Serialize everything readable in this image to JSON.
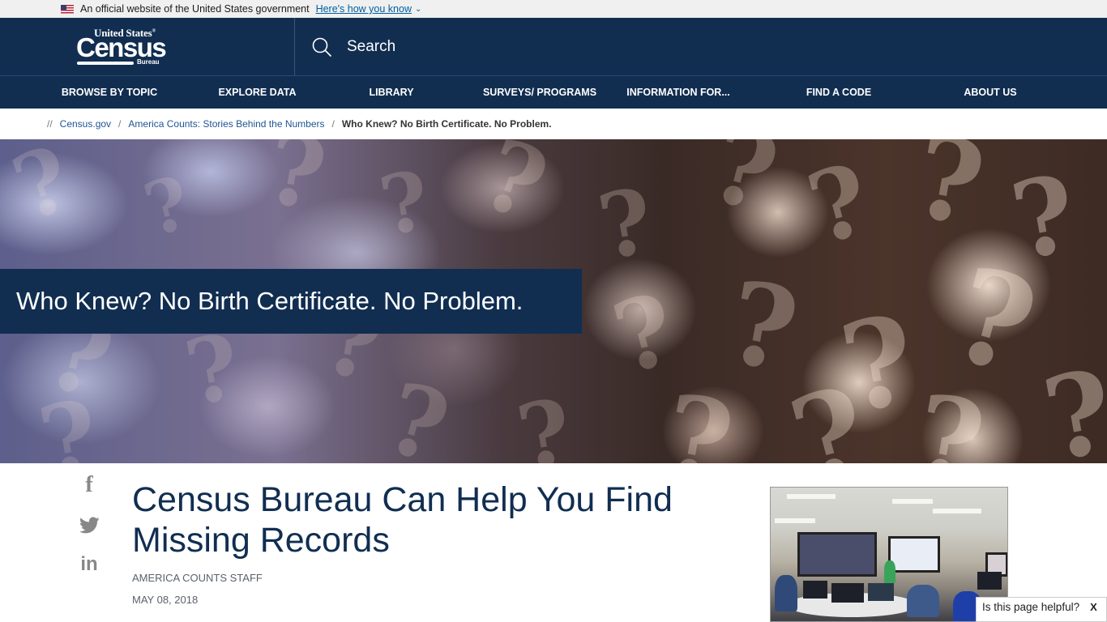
{
  "gov_banner": {
    "text": "An official website of the United States government",
    "link": "Here's how you know",
    "flag_icon": "us-flag-icon",
    "chevron_icon": "chevron-down-icon"
  },
  "header": {
    "logo": {
      "united_states": "United States",
      "registered": "®",
      "census": "Census",
      "bureau": "Bureau"
    },
    "search_label": "Search",
    "search_icon": "search-icon"
  },
  "nav": {
    "items": [
      {
        "label": "BROWSE BY TOPIC"
      },
      {
        "label": "EXPLORE DATA"
      },
      {
        "label": "LIBRARY"
      },
      {
        "label": "SURVEYS/ PROGRAMS"
      },
      {
        "label": "INFORMATION FOR..."
      },
      {
        "label": "FIND A CODE"
      },
      {
        "label": "ABOUT US"
      }
    ]
  },
  "breadcrumb": {
    "prefix": "//",
    "separator": "/",
    "items": [
      {
        "label": "Census.gov"
      },
      {
        "label": "America Counts: Stories Behind the Numbers"
      },
      {
        "label": "Who Knew? No Birth Certificate. No Problem."
      }
    ]
  },
  "hero": {
    "title": "Who Knew? No Birth Certificate. No Problem.",
    "background": "question-marks-image"
  },
  "article": {
    "title": "Census Bureau Can Help You Find Missing Records",
    "author": "AMERICA COUNTS STAFF",
    "date": "MAY 08, 2018",
    "share": [
      {
        "icon": "facebook-icon",
        "glyph": "f"
      },
      {
        "icon": "twitter-icon",
        "glyph": ""
      },
      {
        "icon": "linkedin-icon",
        "glyph": "in"
      }
    ],
    "image": "training-room-photo"
  },
  "feedback": {
    "label": "Is this page helpful?",
    "close": "X"
  },
  "colors": {
    "brand_navy": "#112e51",
    "link_blue": "#205493",
    "gov_link": "#005ea2",
    "icon_gray": "#888888"
  }
}
